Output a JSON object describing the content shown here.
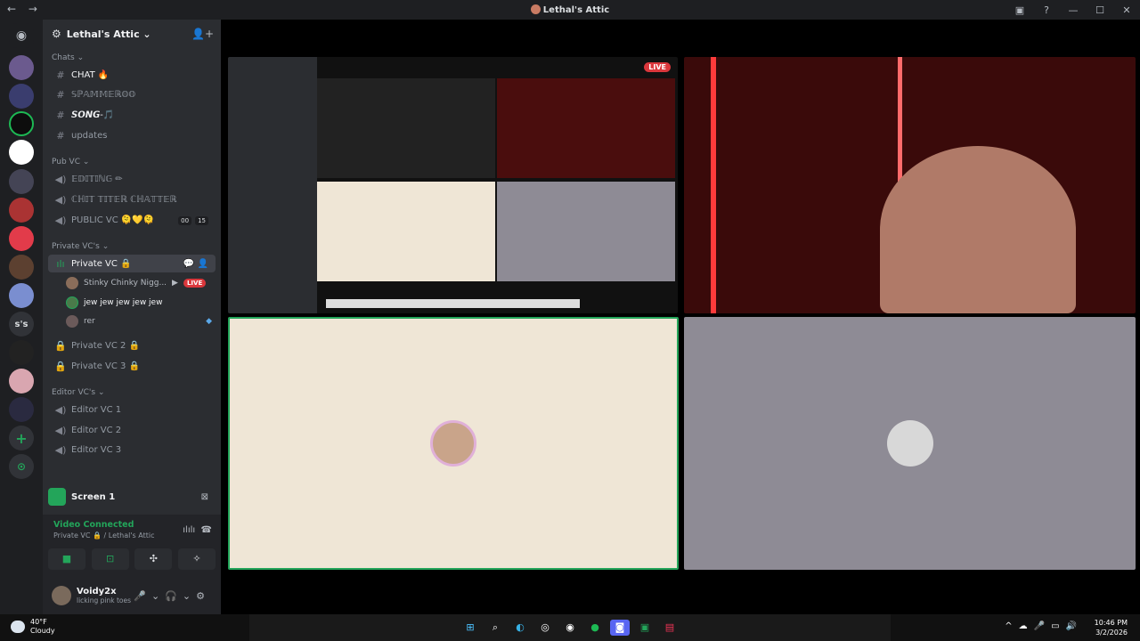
{
  "window": {
    "title": "Lethal's Attic",
    "back": "←",
    "forward": "→",
    "inbox": "▣",
    "help": "?",
    "minimize": "—",
    "maximize": "☐",
    "close": "✕"
  },
  "guild": {
    "name": "Lethal's Attic ⌄",
    "icon": "⚙",
    "invite_icon": "👤+"
  },
  "categories": {
    "chats": "Chats ⌄",
    "pub_vc": "Pub VC ⌄",
    "private_vc": "Private VC's ⌄",
    "editor_vc": "Editor VC's ⌄"
  },
  "channels": {
    "chat": "CHAT 🔥",
    "spam": "𝕊ℙ𝔸𝕄𝕄𝔼ℝ𝕆𝕆",
    "song": "𝙎𝙊𝙉𝙂-🎵",
    "updates": "updates",
    "editing": "𝔼𝔻𝕀𝕋𝕀ℕ𝔾 ✏",
    "chitter": "ℂℍ𝕀𝕋 𝕋𝕀𝕋𝔼ℝ ℂℍ𝔸𝕋𝕋𝔼ℝ",
    "public_vc": "PUBLIC VC 🫠💛🫠",
    "public_vc_count_a": "00",
    "public_vc_count_b": "15",
    "private_vc": "Private VC 🔒",
    "private_vc2": "Private VC 2 🔒",
    "private_vc3": "Private VC 3 🔒",
    "editor1": "Editor VC 1",
    "editor2": "Editor VC 2",
    "editor3": "Editor VC 3"
  },
  "voice_users": [
    {
      "name": "Stinky Chinky Nigg...",
      "live": "LIVE"
    },
    {
      "name": "jew jew jew jew jew"
    },
    {
      "name": "rer"
    }
  ],
  "screen_share": {
    "label": "Screen 1"
  },
  "voice_status": {
    "connected": "Video Connected",
    "location": "Private VC 🔒 / Lethal's Attic"
  },
  "user": {
    "name": "Voidy2x",
    "status": "licking pink toes"
  },
  "stage": {
    "live_badge": "LIVE"
  },
  "taskbar": {
    "temp": "40°F",
    "condition": "Cloudy",
    "time": "10:46 PM",
    "date": "3/2/2026"
  },
  "colors": {
    "accent_green": "#23a55a",
    "live_red": "#da373c",
    "sidebar": "#2b2d31"
  }
}
